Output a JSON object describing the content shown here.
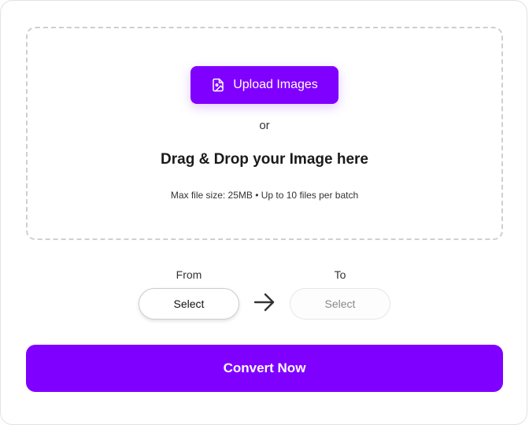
{
  "dropzone": {
    "upload_button_label": "Upload Images",
    "upload_icon": "image-file-icon",
    "or_text": "or",
    "drag_text": "Drag & Drop your Image here",
    "limits_text": "Max file size: 25MB • Up to 10 files per batch"
  },
  "format": {
    "from_label": "From",
    "from_value": "Select",
    "to_label": "To",
    "to_value": "Select",
    "arrow_icon": "arrow-right-icon"
  },
  "actions": {
    "convert_label": "Convert Now"
  },
  "colors": {
    "accent": "#8000ff",
    "border": "#e2e2e2",
    "dashed_border": "#cfcfcf"
  }
}
